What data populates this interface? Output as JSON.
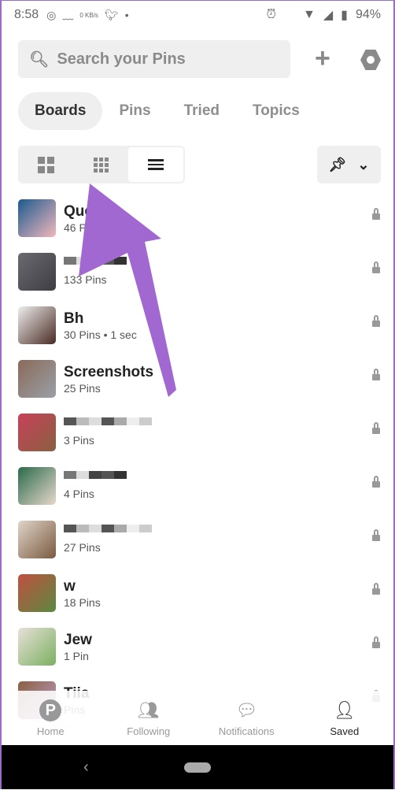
{
  "status_bar": {
    "time": "8:58",
    "net_speed": "0 KB/s",
    "battery": "94%",
    "icons": [
      "whatsapp-icon",
      "mustache-icon",
      "twitter-icon",
      "dot-icon",
      "alarm-icon",
      "wifi-icon",
      "signal-icon",
      "battery-icon"
    ]
  },
  "search": {
    "placeholder": "Search your Pins"
  },
  "header_actions": {
    "add": "+",
    "settings": "settings-icon"
  },
  "tabs": [
    {
      "label": "Boards",
      "active": true
    },
    {
      "label": "Pins"
    },
    {
      "label": "Tried"
    },
    {
      "label": "Topics"
    }
  ],
  "view_modes": [
    "large-grid",
    "small-grid",
    "list"
  ],
  "active_view": "list",
  "sort": {
    "icon": "pin-clock-icon",
    "chevron": "⌄"
  },
  "boards": [
    {
      "title": "Quo",
      "pins": "46 Pins",
      "colors": [
        "#1b5a8e",
        "#f2b8bd"
      ]
    },
    {
      "title": "",
      "pins": "133 Pins",
      "colors": [
        "#6b6a70",
        "#3e3d43"
      ]
    },
    {
      "title": "Bh",
      "pins": "30 Pins • 1 sec",
      "colors": [
        "#eee",
        "#4a2a22"
      ]
    },
    {
      "title": "Screenshots",
      "pins": "25 Pins",
      "colors": [
        "#8a6a58",
        "#9aa0a8"
      ]
    },
    {
      "title": "",
      "pins": "3 Pins",
      "colors": [
        "#c8405a",
        "#8a6040"
      ]
    },
    {
      "title": "",
      "pins": "4 Pins",
      "colors": [
        "#2a6a4a",
        "#e8d8cc"
      ]
    },
    {
      "title": "",
      "pins": "27 Pins",
      "colors": [
        "#e0d4c8",
        "#7a5a40"
      ]
    },
    {
      "title": "w",
      "pins": "18 Pins",
      "colors": [
        "#c05040",
        "#5a8a40"
      ]
    },
    {
      "title": "Jew",
      "pins": "1 Pin",
      "colors": [
        "#e8e0d8",
        "#7ab060"
      ]
    },
    {
      "title": "Tiia",
      "pins": "Pins",
      "colors": [
        "#8a6040",
        "#c0a0d0"
      ]
    }
  ],
  "bottom_nav": [
    {
      "label": "Home",
      "icon": "pinterest-icon"
    },
    {
      "label": "Following",
      "icon": "people-icon"
    },
    {
      "label": "Notifications",
      "icon": "chat-icon"
    },
    {
      "label": "Saved",
      "icon": "person-icon",
      "active": true
    }
  ],
  "annotation_color": "#a068d0",
  "system_nav": {
    "back": "‹"
  }
}
